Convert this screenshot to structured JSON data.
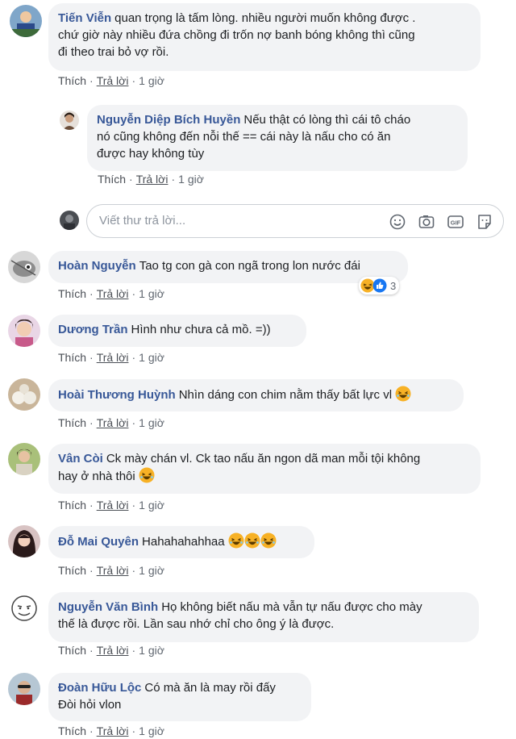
{
  "comments": [
    {
      "name": "Tiến Viễn",
      "line1": "quan trọng là tấm lòng. nhiều người muốn không được .",
      "line2": "chứ giờ này nhiều đứa chồng đi trốn nợ banh bóng không thì cũng",
      "line3": "đi theo trai bỏ vợ rồi.",
      "time": "1 giờ"
    },
    {
      "name": "Nguyễn Diệp Bích Huyền",
      "line1": "Nếu thật có lòng thì cái tô cháo",
      "line2": "nó cũng không đến nỗi thế == cái này là nấu cho có ăn",
      "line3": "được hay không tùy",
      "time": "1 giờ"
    },
    {
      "name": "Hoàn Nguyễn",
      "line1": "Tao tg con gà con ngã trong lon nước đái",
      "time": "1 giờ",
      "reaction_count": "3"
    },
    {
      "name": "Dương Trần",
      "line1": "Hình như chưa cả mồ. =))",
      "time": "1 giờ"
    },
    {
      "name": "Hoài Thương Huỳnh",
      "line1": "Nhìn dáng con chim nằm thấy bất lực vl",
      "time": "1 giờ"
    },
    {
      "name": "Vân Còi",
      "line1": "Ck mày chán vl. Ck tao nấu ăn ngon dã man mỗi tội không",
      "line2": "hay ở nhà thôi",
      "time": "1 giờ"
    },
    {
      "name": "Đỗ Mai Quyên",
      "line1": "Hahahahahhaa",
      "time": "1 giờ"
    },
    {
      "name": "Nguyễn Văn Bình",
      "line1": "Họ không biết nấu mà vẫn tự nấu được cho mày",
      "line2": "thế là được rồi. Lần sau nhớ chỉ cho ông ý là được.",
      "time": "1 giờ"
    },
    {
      "name": "Đoàn Hữu Lộc",
      "line1": "Có mà ăn là may rồi đấy",
      "line2": "Đòi hỏi vlon",
      "time": "1 giờ"
    }
  ],
  "actions": {
    "like": "Thích",
    "reply": "Trả lời",
    "sep": "·"
  },
  "composer": {
    "placeholder": "Viết thư trả lời..."
  },
  "icons": [
    "smiley-icon",
    "camera-icon",
    "gif-icon",
    "sticker-icon",
    "like-reaction-icon",
    "haha-reaction-icon"
  ],
  "colors": {
    "name": "#385898",
    "bubble": "#f2f3f5",
    "meta": "#606770",
    "like_blue": "#1877f2",
    "haha_yellow": "#f7b125"
  }
}
